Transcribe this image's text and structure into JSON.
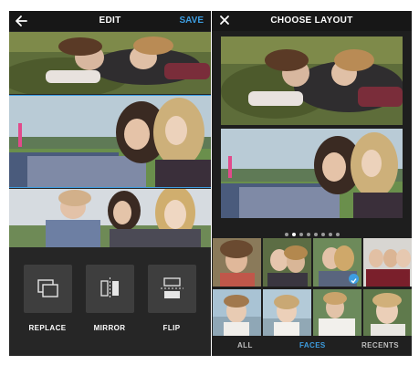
{
  "left_panel": {
    "title": "EDIT",
    "save_label": "SAVE",
    "tools": [
      {
        "label": "REPLACE",
        "icon": "replace-icon"
      },
      {
        "label": "MIRROR",
        "icon": "mirror-icon"
      },
      {
        "label": "FLIP",
        "icon": "flip-icon"
      }
    ]
  },
  "right_panel": {
    "title": "CHOOSE LAYOUT",
    "page_dots": {
      "total": 8,
      "active": 1
    },
    "tabs": [
      "ALL",
      "FACES",
      "RECENTS"
    ],
    "active_tab": "FACES"
  },
  "colors": {
    "accent": "#3d9de0",
    "toolbar": "#171717",
    "panel": "#262626",
    "tool_button": "#3e3e3e"
  }
}
